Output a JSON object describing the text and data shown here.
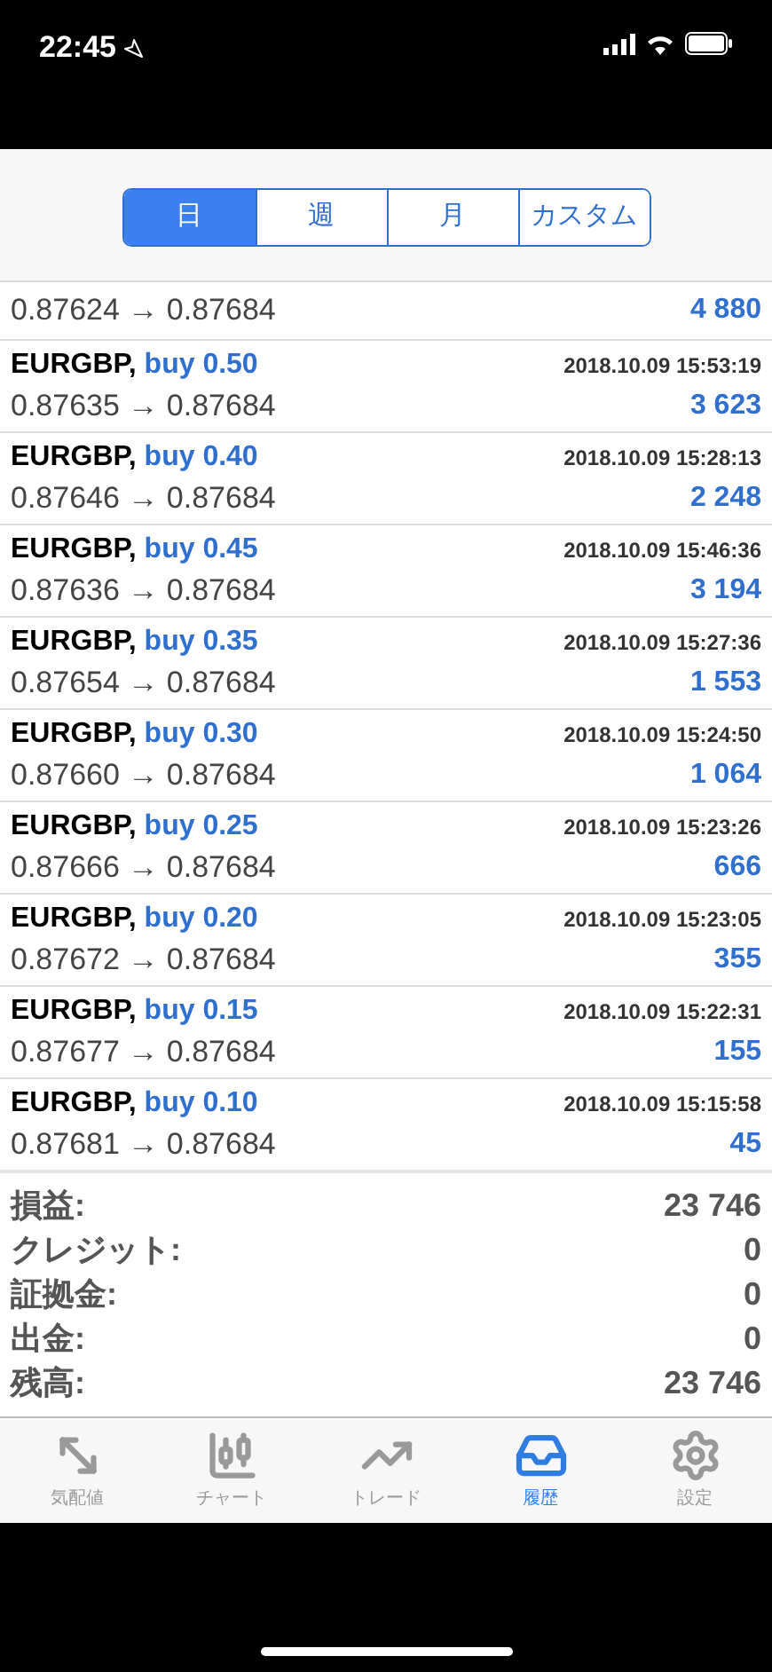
{
  "status_bar": {
    "time": "22:45"
  },
  "period_tabs": [
    {
      "label": "日",
      "selected": true
    },
    {
      "label": "週",
      "selected": false
    },
    {
      "label": "月",
      "selected": false
    },
    {
      "label": "カスタム",
      "selected": false
    }
  ],
  "deals": [
    {
      "prices": "0.87624 → 0.87684",
      "profit": "4 880"
    },
    {
      "symbol": "EURGBP,",
      "side": "buy 0.50",
      "time": "2018.10.09 15:53:19",
      "prices": "0.87635 → 0.87684",
      "profit": "3 623"
    },
    {
      "symbol": "EURGBP,",
      "side": "buy 0.40",
      "time": "2018.10.09 15:28:13",
      "prices": "0.87646 → 0.87684",
      "profit": "2 248"
    },
    {
      "symbol": "EURGBP,",
      "side": "buy 0.45",
      "time": "2018.10.09 15:46:36",
      "prices": "0.87636 → 0.87684",
      "profit": "3 194"
    },
    {
      "symbol": "EURGBP,",
      "side": "buy 0.35",
      "time": "2018.10.09 15:27:36",
      "prices": "0.87654 → 0.87684",
      "profit": "1 553"
    },
    {
      "symbol": "EURGBP,",
      "side": "buy 0.30",
      "time": "2018.10.09 15:24:50",
      "prices": "0.87660 → 0.87684",
      "profit": "1 064"
    },
    {
      "symbol": "EURGBP,",
      "side": "buy 0.25",
      "time": "2018.10.09 15:23:26",
      "prices": "0.87666 → 0.87684",
      "profit": "666"
    },
    {
      "symbol": "EURGBP,",
      "side": "buy 0.20",
      "time": "2018.10.09 15:23:05",
      "prices": "0.87672 → 0.87684",
      "profit": "355"
    },
    {
      "symbol": "EURGBP,",
      "side": "buy 0.15",
      "time": "2018.10.09 15:22:31",
      "prices": "0.87677 → 0.87684",
      "profit": "155"
    },
    {
      "symbol": "EURGBP,",
      "side": "buy 0.10",
      "time": "2018.10.09 15:15:58",
      "prices": "0.87681 → 0.87684",
      "profit": "45"
    }
  ],
  "totals": [
    {
      "label": "損益:",
      "value": "23 746"
    },
    {
      "label": "クレジット:",
      "value": "0"
    },
    {
      "label": "証拠金:",
      "value": "0"
    },
    {
      "label": "出金:",
      "value": "0"
    },
    {
      "label": "残高:",
      "value": "23 746"
    }
  ],
  "tab_bar": [
    {
      "kind": "quotes",
      "label": "気配値",
      "selected": false
    },
    {
      "kind": "chart",
      "label": "チャート",
      "selected": false
    },
    {
      "kind": "trade",
      "label": "トレード",
      "selected": false
    },
    {
      "kind": "history",
      "label": "履歴",
      "selected": true
    },
    {
      "kind": "settings",
      "label": "設定",
      "selected": false
    }
  ]
}
